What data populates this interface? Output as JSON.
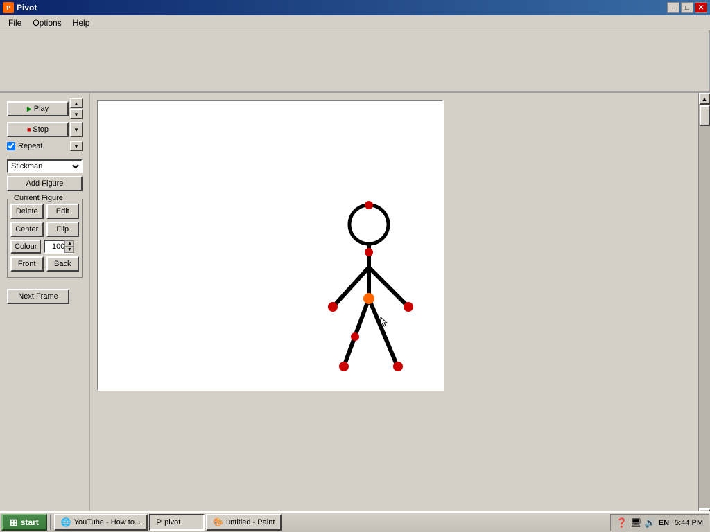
{
  "titlebar": {
    "title": "Pivot",
    "minimize": "–",
    "maximize": "□",
    "close": "✕"
  },
  "menubar": {
    "items": [
      "File",
      "Options",
      "Help"
    ]
  },
  "controls": {
    "play_label": "Play",
    "stop_label": "Stop",
    "repeat_label": "Repeat",
    "figure_options": [
      "Stickman"
    ],
    "selected_figure": "Stickman",
    "add_figure_label": "Add Figure",
    "current_figure_label": "Current Figure",
    "delete_label": "Delete",
    "edit_label": "Edit",
    "center_label": "Center",
    "flip_label": "Flip",
    "colour_label": "Colour",
    "colour_value": "100",
    "front_label": "Front",
    "back_label": "Back",
    "next_frame_label": "Next Frame"
  },
  "taskbar": {
    "start_label": "start",
    "items": [
      {
        "label": "YouTube - How to...",
        "icon": "ie-icon"
      },
      {
        "label": "pivot",
        "icon": "pivot-icon"
      },
      {
        "label": "untitled - Paint",
        "icon": "paint-icon"
      }
    ],
    "time": "5:44 PM",
    "tray_icons": [
      "question-icon",
      "network-icon",
      "volume-icon",
      "lang-icon"
    ]
  }
}
